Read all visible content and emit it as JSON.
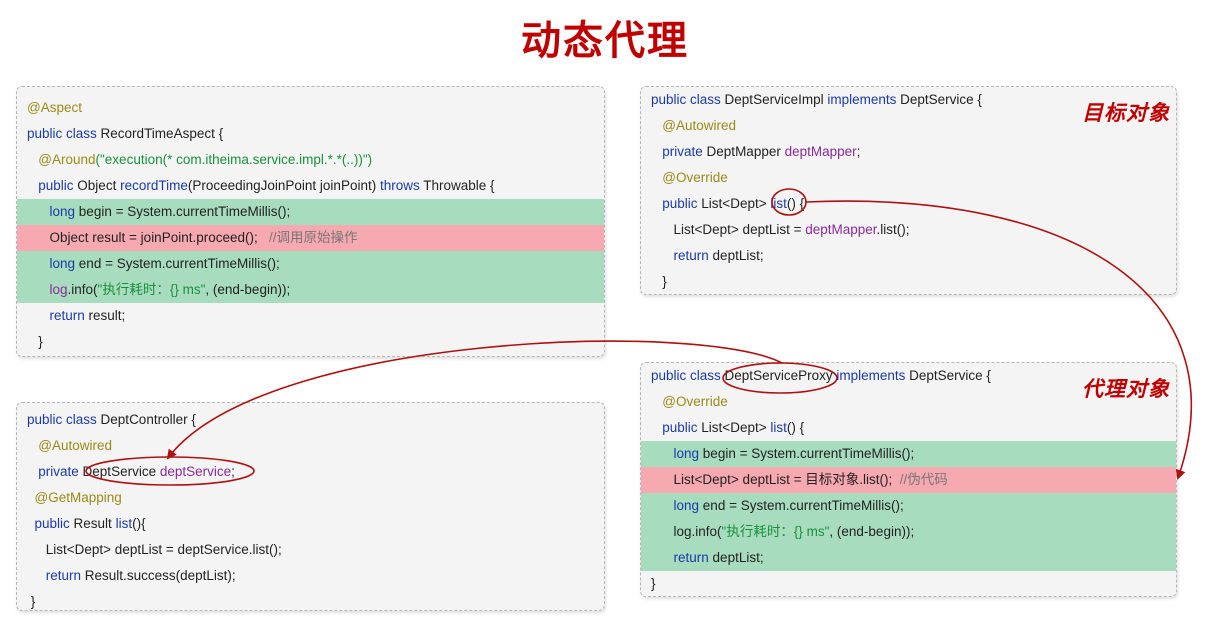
{
  "title": "动态代理",
  "aspect_box": {
    "lines": [
      [
        {
          "t": "@Aspect",
          "c": "ann"
        }
      ],
      [
        {
          "t": "public class ",
          "c": "kw"
        },
        {
          "t": "RecordTimeAspect {",
          "c": "plain"
        }
      ],
      [
        {
          "t": "   "
        },
        {
          "t": "@Around",
          "c": "ann"
        },
        {
          "t": "(\"execution(* com.itheima.service.impl.*.*(..))\")",
          "c": "str"
        }
      ],
      [
        {
          "t": "   "
        },
        {
          "t": "public ",
          "c": "kw"
        },
        {
          "t": "Object ",
          "c": "plain"
        },
        {
          "t": "recordTime",
          "c": "kw"
        },
        {
          "t": "(ProceedingJoinPoint joinPoint) ",
          "c": "plain"
        },
        {
          "t": "throws ",
          "c": "kw"
        },
        {
          "t": "Throwable {",
          "c": "plain"
        }
      ],
      [
        {
          "t": "      "
        },
        {
          "t": "long ",
          "c": "kw"
        },
        {
          "t": "begin = System.currentTimeMillis();",
          "c": "plain"
        }
      ],
      [
        {
          "t": "      "
        },
        {
          "t": "Object result = joinPoint.proceed();   ",
          "c": "plain"
        },
        {
          "t": "//调用原始操作",
          "c": "cmt"
        }
      ],
      [
        {
          "t": "      "
        },
        {
          "t": "long ",
          "c": "kw"
        },
        {
          "t": "end = System.currentTimeMillis();",
          "c": "plain"
        }
      ],
      [
        {
          "t": "      "
        },
        {
          "t": "log",
          "c": "fld"
        },
        {
          "t": ".info(",
          "c": "plain"
        },
        {
          "t": "\"执行耗时：{} ms\"",
          "c": "str"
        },
        {
          "t": ", (end-begin));",
          "c": "plain"
        }
      ],
      [
        {
          "t": "      "
        },
        {
          "t": "return ",
          "c": "kw"
        },
        {
          "t": "result;",
          "c": "plain"
        }
      ],
      [
        {
          "t": "   }",
          "c": "plain"
        }
      ]
    ]
  },
  "controller_box": {
    "lines": [
      [
        {
          "t": "public class ",
          "c": "kw"
        },
        {
          "t": "DeptController {",
          "c": "plain"
        }
      ],
      [
        {
          "t": "   "
        },
        {
          "t": "@Autowired",
          "c": "ann"
        }
      ],
      [
        {
          "t": "   "
        },
        {
          "t": "private ",
          "c": "kw"
        },
        {
          "t": "DeptService ",
          "c": "plain"
        },
        {
          "t": "deptService",
          "c": "fld"
        },
        {
          "t": ";",
          "c": "plain"
        }
      ],
      [
        {
          "t": "  "
        },
        {
          "t": "@GetMapping",
          "c": "ann"
        }
      ],
      [
        {
          "t": "  "
        },
        {
          "t": "public ",
          "c": "kw"
        },
        {
          "t": "Result ",
          "c": "plain"
        },
        {
          "t": "list",
          "c": "kw"
        },
        {
          "t": "(){",
          "c": "plain"
        }
      ],
      [
        {
          "t": "     "
        },
        {
          "t": "List<Dept> deptList = deptService.list();",
          "c": "plain"
        }
      ],
      [
        {
          "t": "     "
        },
        {
          "t": "return ",
          "c": "kw"
        },
        {
          "t": "Result.success(deptList);",
          "c": "plain"
        }
      ],
      [
        {
          "t": " }",
          "c": "plain"
        }
      ]
    ]
  },
  "target_box": {
    "tag": "目标对象",
    "lines": [
      [
        {
          "t": "public class ",
          "c": "kw"
        },
        {
          "t": "DeptServiceImpl ",
          "c": "plain"
        },
        {
          "t": "implements ",
          "c": "kw"
        },
        {
          "t": "DeptService {",
          "c": "plain"
        }
      ],
      [
        {
          "t": "   "
        },
        {
          "t": "@Autowired",
          "c": "ann"
        }
      ],
      [
        {
          "t": "   "
        },
        {
          "t": "private ",
          "c": "kw"
        },
        {
          "t": "DeptMapper ",
          "c": "plain"
        },
        {
          "t": "deptMapper",
          "c": "fld"
        },
        {
          "t": ";",
          "c": "plain"
        }
      ],
      [
        {
          "t": "   "
        },
        {
          "t": "@Override",
          "c": "ann"
        }
      ],
      [
        {
          "t": "   "
        },
        {
          "t": "public ",
          "c": "kw"
        },
        {
          "t": "List<Dept> ",
          "c": "plain"
        },
        {
          "t": "list",
          "c": "kw"
        },
        {
          "t": "() {",
          "c": "plain"
        }
      ],
      [
        {
          "t": "      "
        },
        {
          "t": "List<Dept> deptList = ",
          "c": "plain"
        },
        {
          "t": "deptMapper",
          "c": "fld"
        },
        {
          "t": ".list();",
          "c": "plain"
        }
      ],
      [
        {
          "t": "      "
        },
        {
          "t": "return ",
          "c": "kw"
        },
        {
          "t": "deptList;",
          "c": "plain"
        }
      ],
      [
        {
          "t": "   }",
          "c": "plain"
        }
      ]
    ]
  },
  "proxy_box": {
    "tag": "代理对象",
    "lines": [
      [
        {
          "t": "public class ",
          "c": "kw"
        },
        {
          "t": "DeptServiceProxy ",
          "c": "plain"
        },
        {
          "t": "implements ",
          "c": "kw"
        },
        {
          "t": "DeptService {",
          "c": "plain"
        }
      ],
      [
        {
          "t": "   "
        },
        {
          "t": "@Override",
          "c": "ann"
        }
      ],
      [
        {
          "t": "   "
        },
        {
          "t": "public ",
          "c": "kw"
        },
        {
          "t": "List<Dept> ",
          "c": "plain"
        },
        {
          "t": "list",
          "c": "kw"
        },
        {
          "t": "() {",
          "c": "plain"
        }
      ],
      [
        {
          "t": "      "
        },
        {
          "t": "long ",
          "c": "kw"
        },
        {
          "t": "begin = System.currentTimeMillis();",
          "c": "plain"
        }
      ],
      [
        {
          "t": "      "
        },
        {
          "t": "List<Dept> deptList = 目标对象.list();  ",
          "c": "plain"
        },
        {
          "t": "//伪代码",
          "c": "cmt"
        }
      ],
      [
        {
          "t": "      "
        },
        {
          "t": "long ",
          "c": "kw"
        },
        {
          "t": "end = System.currentTimeMillis();",
          "c": "plain"
        }
      ],
      [
        {
          "t": "      "
        },
        {
          "t": "log.info(",
          "c": "plain"
        },
        {
          "t": "\"执行耗时：{} ms\"",
          "c": "str"
        },
        {
          "t": ", (end-begin));",
          "c": "plain"
        }
      ],
      [
        {
          "t": "      "
        },
        {
          "t": "return ",
          "c": "kw"
        },
        {
          "t": "deptList;",
          "c": "plain"
        }
      ],
      [
        {
          "t": "}",
          "c": "plain"
        }
      ]
    ]
  },
  "colors": {
    "title": "#c00000",
    "highlight_green": "#a8dcbf",
    "highlight_red": "#f6a9b0",
    "arrow": "#b01010"
  }
}
